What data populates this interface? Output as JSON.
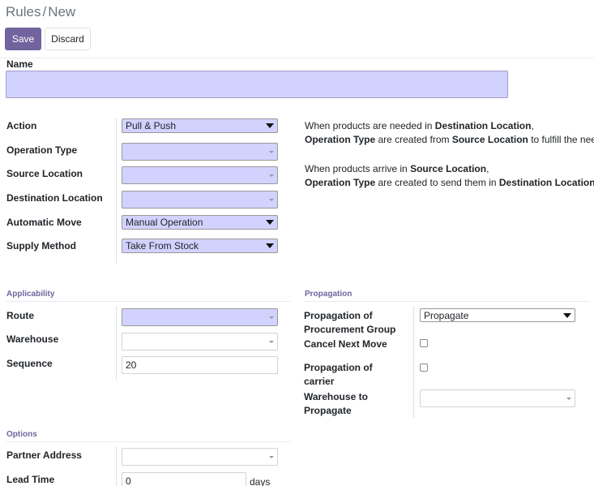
{
  "breadcrumb": {
    "parent": "Rules",
    "separator": "/",
    "current": "New"
  },
  "toolbar": {
    "save_label": "Save",
    "discard_label": "Discard"
  },
  "form": {
    "name_label": "Name",
    "name_value": "",
    "action": {
      "label": "Action",
      "value": "Pull & Push"
    },
    "operation_type": {
      "label": "Operation Type",
      "value": ""
    },
    "source_location": {
      "label": "Source Location",
      "value": ""
    },
    "destination_location": {
      "label": "Destination Location",
      "value": ""
    },
    "automatic_move": {
      "label": "Automatic Move",
      "value": "Manual Operation"
    },
    "supply_method": {
      "label": "Supply Method",
      "value": "Take From Stock"
    }
  },
  "help": {
    "p1_l1_a": "When products are needed in ",
    "p1_l1_b": "Destination Location",
    "p1_l1_c": ",",
    "p1_l2_a": "Operation Type",
    "p1_l2_b": " are created from ",
    "p1_l2_c": "Source Location",
    "p1_l2_d": " to fulfill the need",
    "p2_l1_a": "When products arrive in ",
    "p2_l1_b": "Source Location",
    "p2_l1_c": ",",
    "p2_l2_a": "Operation Type",
    "p2_l2_b": " are created to send them in ",
    "p2_l2_c": "Destination Location",
    "p2_l2_d": "."
  },
  "applicability": {
    "title": "Applicability",
    "route": {
      "label": "Route",
      "value": ""
    },
    "warehouse": {
      "label": "Warehouse",
      "value": ""
    },
    "sequence": {
      "label": "Sequence",
      "value": "20"
    }
  },
  "propagation": {
    "title": "Propagation",
    "group_label_1": "Propagation of",
    "group_label_2": "Procurement Group",
    "group_value": "Propagate",
    "cancel_next_move_label": "Cancel Next Move",
    "cancel_next_move_checked": false,
    "carrier_label_1": "Propagation of",
    "carrier_label_2": "carrier",
    "carrier_checked": false,
    "warehouse_label_1": "Warehouse to",
    "warehouse_label_2": "Propagate",
    "warehouse_value": ""
  },
  "options": {
    "title": "Options",
    "partner_address": {
      "label": "Partner Address",
      "value": ""
    },
    "lead_time": {
      "label": "Lead Time",
      "value": "0",
      "unit": "days"
    }
  },
  "colors": {
    "primary": "#71639e",
    "required_bg": "#d2d2ff"
  }
}
